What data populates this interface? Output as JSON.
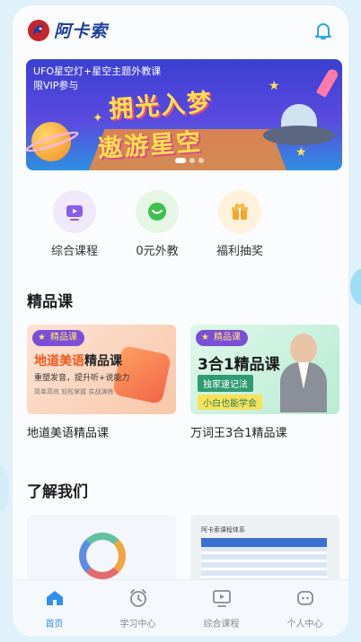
{
  "header": {
    "app_name": "阿卡索"
  },
  "banner": {
    "subtitle_line1": "UFO星空灯+星空主题外教课",
    "subtitle_line2": "限VIP参与",
    "title_line1": "拥光入梦",
    "title_line2": "遨游星空"
  },
  "quick_nav": [
    {
      "label": "综合课程",
      "icon": "tv-icon"
    },
    {
      "label": "0元外教",
      "icon": "chat-icon"
    },
    {
      "label": "福利抽奖",
      "icon": "gift-icon"
    }
  ],
  "featured": {
    "title": "精品课",
    "cards": [
      {
        "tag": "精品课",
        "thumb_title_a": "地道美语",
        "thumb_title_b": "精品课",
        "thumb_line2": "重塑发音，提升听+说能力",
        "thumb_line3": "简单高效  轻松掌握  实战演练",
        "name": "地道美语精品课"
      },
      {
        "tag": "精品课",
        "thumb_title": "3合1精品课",
        "thumb_box1": "独家速记法",
        "thumb_box2": "小白也能学会",
        "name": "万词王3合1精品课"
      }
    ]
  },
  "about": {
    "title": "了解我们",
    "card2_title": "阿卡索课程体系"
  },
  "tabbar": [
    {
      "label": "首页",
      "icon": "home-icon",
      "active": true
    },
    {
      "label": "学习中心",
      "icon": "alarm-clock-icon",
      "active": false
    },
    {
      "label": "综合课程",
      "icon": "tv-icon",
      "active": false
    },
    {
      "label": "个人中心",
      "icon": "profile-icon",
      "active": false
    }
  ],
  "colors": {
    "accent": "#2f8ff0",
    "brand": "#1e3f99"
  }
}
